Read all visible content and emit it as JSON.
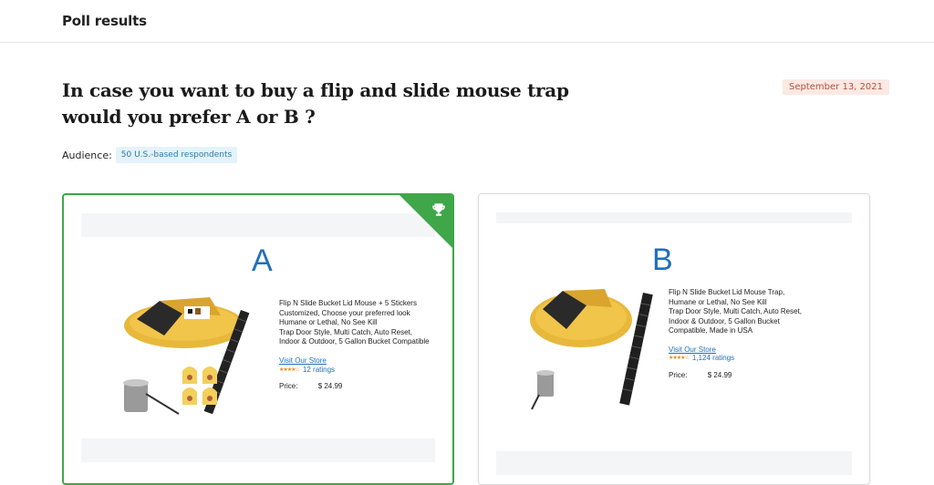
{
  "header": {
    "title": "Poll results"
  },
  "poll": {
    "question": "In case you want to buy a flip and slide mouse trap would you prefer A or B ?",
    "date": "September 13, 2021",
    "audience_label": "Audience:",
    "audience_value": "50 U.S.-based respondents"
  },
  "options": [
    {
      "letter": "A",
      "winner": true,
      "winner_icon": "trophy-icon",
      "description_lines": [
        "Flip N Slide Bucket Lid Mouse + 5 Stickers",
        "Customized, Choose your preferred look",
        "Humane or Lethal, No See Kill",
        "Trap Door Style, Multi Catch, Auto Reset,",
        "Indoor & Outdoor, 5 Gallon Bucket Compatible"
      ],
      "store_link": "Visit Our Store",
      "stars": "★★★★☆",
      "ratings": "12 ratings",
      "price_label": "Price:",
      "price_value": "$ 24.99"
    },
    {
      "letter": "B",
      "winner": false,
      "description_lines": [
        "Flip N Slide Bucket Lid Mouse Trap,",
        "Humane or Lethal, No See Kill",
        "Trap Door Style, Multi Catch, Auto Reset,",
        "Indoor & Outdoor, 5 Gallon Bucket",
        "Compatible, Made in USA"
      ],
      "store_link": "Visit Our Store",
      "stars": "★★★★☆",
      "ratings": "1,124 ratings",
      "price_label": "Price:",
      "price_value": "$ 24.99"
    }
  ],
  "colors": {
    "winner_green": "#3fa64a",
    "link_blue": "#1f70b8",
    "date_bg": "#fbe9e4",
    "date_text": "#b3533a",
    "audience_bg": "#e4f3fb",
    "audience_text": "#2a7aa8",
    "trap_yellow": "#e8b83a"
  }
}
